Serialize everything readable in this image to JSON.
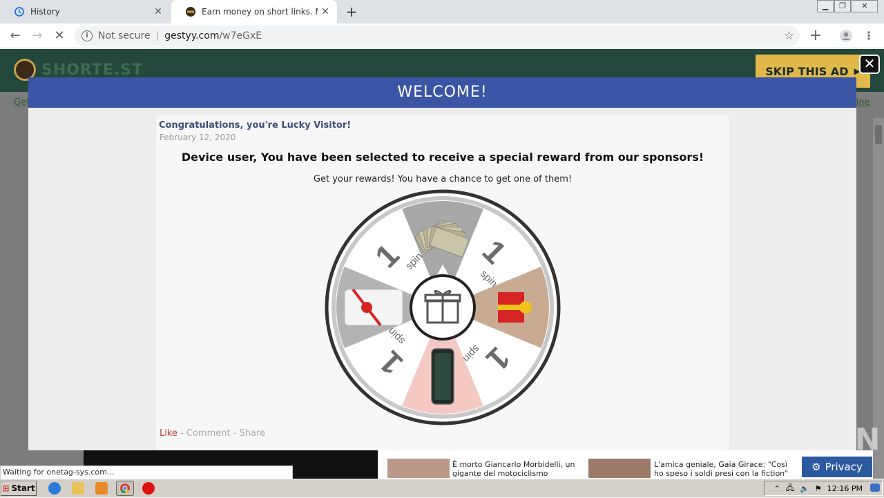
{
  "browser": {
    "tabs": [
      {
        "title": "History",
        "icon": "history-icon",
        "active": false
      },
      {
        "title": "Earn money on short links. Make sho",
        "icon": "site-favicon",
        "active": true
      }
    ],
    "new_tab": "+",
    "address": {
      "security": "Not secure",
      "host": "gestyy.com",
      "path": "/w7eGxE"
    },
    "status": "Waiting for onetag-sys.com..."
  },
  "site": {
    "logo_text": "SHORTE.ST",
    "skip_ad": "SKIP THIS AD",
    "nav_left": "Get",
    "nav_right": "line"
  },
  "modal": {
    "header": "WELCOME!",
    "card_title": "Congratulations, you're Lucky Visitor!",
    "date": "February 12, 2020",
    "headline": "Device user, You have been selected to receive a special reward from our sponsors!",
    "subline": "Get your rewards! You have a chance to get one of them!",
    "wheel_segments": [
      {
        "label": "cash",
        "icon": "money-icon",
        "color": "#a8a8a8"
      },
      {
        "label": "1 spin",
        "icon": "spin-icon",
        "color": "#ffffff"
      },
      {
        "label": "gift box",
        "icon": "gift-box-icon",
        "color": "#c9ab93"
      },
      {
        "label": "1 spin",
        "icon": "spin-icon",
        "color": "#ffffff"
      },
      {
        "label": "smartphone",
        "icon": "phone-icon",
        "color": "#f4c9c4"
      },
      {
        "label": "1 spin",
        "icon": "spin-icon",
        "color": "#ffffff"
      },
      {
        "label": "gift card",
        "icon": "gift-card-icon",
        "color": "#b3b3b3"
      },
      {
        "label": "1 spin",
        "icon": "spin-icon",
        "color": "#ffffff"
      }
    ],
    "spin_text": "spin",
    "spin_number": "1",
    "footer": {
      "like": "Like",
      "comment": "Comment",
      "share": "Share",
      "sep": " - "
    }
  },
  "news": [
    {
      "text": "È morto Giancarlo Morbidelli, un gigante del motociclismo internazionale"
    },
    {
      "text": "L'amica geniale, Gaia Girace: \"Così ho speso i soldi presi con la fiction\""
    }
  ],
  "privacy_label": "Privacy",
  "watermark": "ANY RUN",
  "taskbar": {
    "start": "Start",
    "clock": "12:16 PM"
  }
}
